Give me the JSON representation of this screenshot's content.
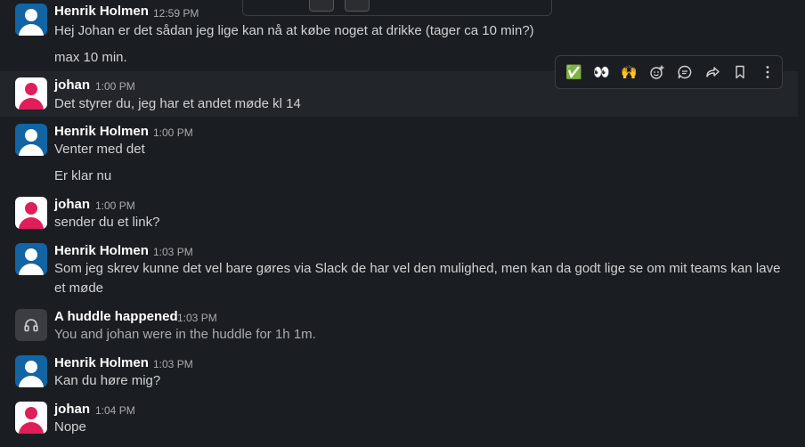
{
  "messages": [
    {
      "author": "Henrik Holmen",
      "time": "12:59 PM",
      "lines": [
        "Hej Johan er det sådan jeg lige kan nå at købe noget at drikke (tager ca 10 min?)",
        "max 10 min."
      ]
    },
    {
      "author": "johan",
      "time": "1:00 PM",
      "lines": [
        "Det styrer du, jeg har et andet møde kl 14"
      ]
    },
    {
      "author": "Henrik Holmen",
      "time": "1:00 PM",
      "lines": [
        "Venter med det",
        "Er klar nu"
      ]
    },
    {
      "author": "johan",
      "time": "1:00 PM",
      "lines": [
        "sender du et link?"
      ]
    },
    {
      "author": "Henrik Holmen",
      "time": "1:03 PM",
      "lines": [
        "Som jeg skrev kunne det vel bare gøres via Slack de har vel den mulighed, men kan da godt lige se om mit teams kan lave et møde"
      ]
    },
    {
      "author": "A huddle happened",
      "time": "1:03 PM",
      "lines": [
        "You and johan were in the huddle for 1h 1m."
      ]
    },
    {
      "author": "Henrik Holmen",
      "time": "1:03 PM",
      "lines": [
        "Kan du høre mig?"
      ]
    },
    {
      "author": "johan",
      "time": "1:04 PM",
      "lines": [
        "Nope"
      ]
    }
  ],
  "action_bar": {
    "items": [
      {
        "icon": "white-check-mark-emoji",
        "glyph": "✅"
      },
      {
        "icon": "eyes-emoji",
        "glyph": "👀"
      },
      {
        "icon": "raised-hands-emoji",
        "glyph": "🙌"
      },
      {
        "icon": "add-reaction-icon"
      },
      {
        "icon": "reply-in-thread-icon"
      },
      {
        "icon": "share-icon"
      },
      {
        "icon": "bookmark-icon"
      },
      {
        "icon": "more-actions-icon"
      }
    ]
  },
  "colors": {
    "background": "#1a1d21",
    "hover_row": "#222529",
    "henrik_avatar": "#1264a3",
    "johan_avatar": "#e01e5a",
    "huddle_avatar": "#3b3d42"
  }
}
